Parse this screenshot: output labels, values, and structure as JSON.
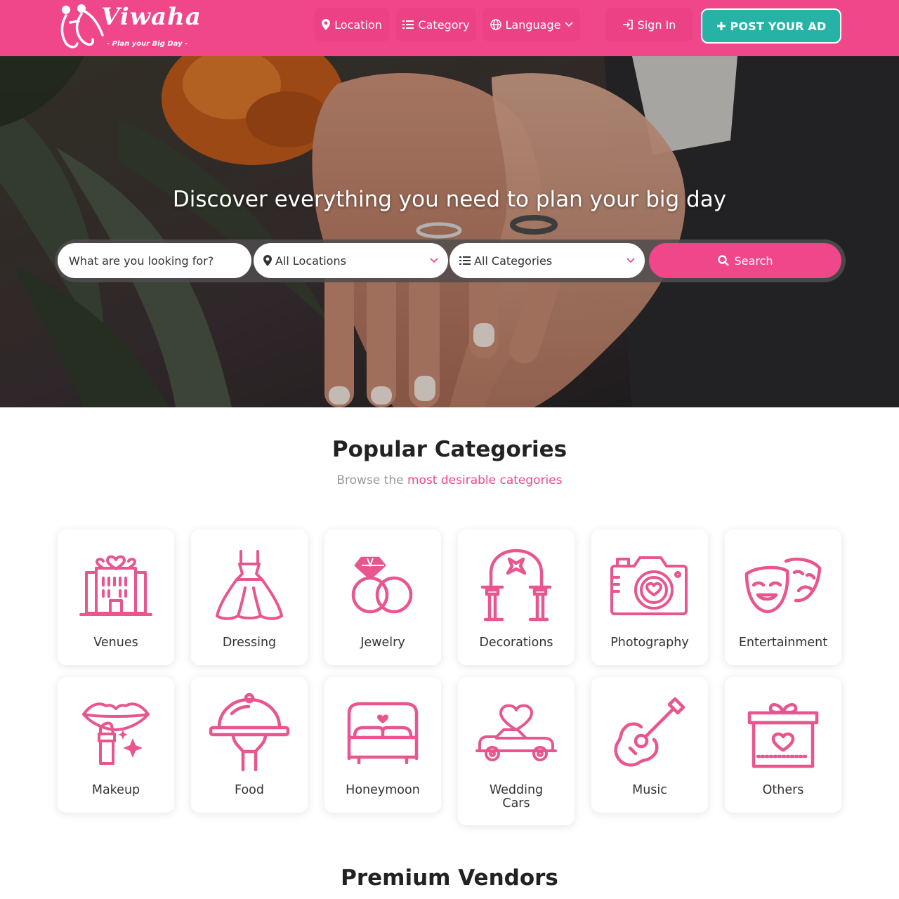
{
  "brand": {
    "name": "Viwaha",
    "tagline": "- Plan your Big Day -"
  },
  "nav": {
    "location": "Location",
    "category": "Category",
    "language": "Language",
    "signin": "Sign In",
    "post_ad": "POST YOUR AD"
  },
  "hero": {
    "title": "Discover everything you need to plan your big day",
    "search_placeholder": "What are you looking for?",
    "location_select": "All Locations",
    "category_select": "All Categories",
    "search_button": "Search"
  },
  "categories": {
    "title": "Popular Categories",
    "subtitle_plain": "Browse the ",
    "subtitle_accent": "most desirable categories",
    "items": [
      {
        "label": "Venues",
        "icon": "venue-icon"
      },
      {
        "label": "Dressing",
        "icon": "dress-icon"
      },
      {
        "label": "Jewelry",
        "icon": "rings-icon"
      },
      {
        "label": "Decorations",
        "icon": "arch-icon"
      },
      {
        "label": "Photography",
        "icon": "camera-icon"
      },
      {
        "label": "Entertainment",
        "icon": "masks-icon"
      },
      {
        "label": "Makeup",
        "icon": "lipstick-icon"
      },
      {
        "label": "Food",
        "icon": "cloche-icon"
      },
      {
        "label": "Honeymoon",
        "icon": "bed-icon"
      },
      {
        "label": "Wedding Cars",
        "icon": "car-icon"
      },
      {
        "label": "Music",
        "icon": "guitar-icon"
      },
      {
        "label": "Others",
        "icon": "gift-icon"
      }
    ]
  },
  "premium": {
    "title": "Premium Vendors"
  },
  "colors": {
    "brand_pink": "#f0468a",
    "post_teal": "#26b3a6",
    "icon_pink": "#e8558f"
  }
}
